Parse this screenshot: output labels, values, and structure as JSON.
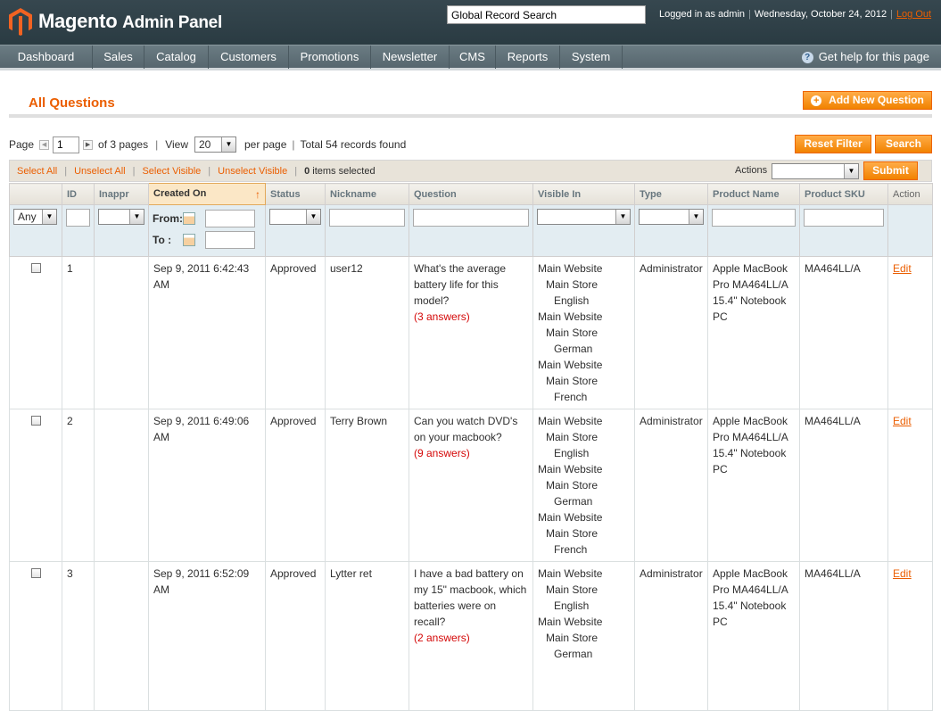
{
  "header": {
    "logo_brand": "Magento",
    "logo_suffix": "Admin Panel",
    "search_placeholder": "Global Record Search",
    "logged_in": "Logged in as admin",
    "date": "Wednesday, October 24, 2012",
    "logout": "Log Out"
  },
  "nav": {
    "items": [
      "Dashboard",
      "Sales",
      "Catalog",
      "Customers",
      "Promotions",
      "Newsletter",
      "CMS",
      "Reports",
      "System"
    ],
    "help": "Get help for this page"
  },
  "page": {
    "title": "All Questions",
    "add_button": "Add New Question"
  },
  "pager": {
    "page_label": "Page",
    "page_value": "1",
    "of_pages": "of 3 pages",
    "view_label": "View",
    "per_page_value": "20",
    "per_page_label": "per page",
    "total": "Total 54 records found",
    "reset_filter": "Reset Filter",
    "search": "Search"
  },
  "massaction": {
    "select_all": "Select All",
    "unselect_all": "Unselect All",
    "select_visible": "Select Visible",
    "unselect_visible": "Unselect Visible",
    "items_selected_count": "0",
    "items_selected_label": "items selected",
    "actions_label": "Actions",
    "submit": "Submit"
  },
  "columns": {
    "id": "ID",
    "inappr": "Inappr",
    "created_on": "Created On",
    "status": "Status",
    "nickname": "Nickname",
    "question": "Question",
    "visible_in": "Visible In",
    "type": "Type",
    "product_name": "Product Name",
    "product_sku": "Product SKU",
    "action": "Action"
  },
  "filters": {
    "any": "Any",
    "from": "From:",
    "to": "To :"
  },
  "rows": [
    {
      "id": "1",
      "created": "Sep 9, 2011 6:42:43 AM",
      "status": "Approved",
      "nickname": "user12",
      "question": "What's the average battery life for this model?",
      "answers": "(3 answers)",
      "type": "Administrator",
      "product_name": "Apple MacBook Pro MA464LL/A 15.4\" Notebook PC",
      "sku": "MA464LL/A",
      "action": "Edit"
    },
    {
      "id": "2",
      "created": "Sep 9, 2011 6:49:06 AM",
      "status": "Approved",
      "nickname": "Terry Brown",
      "question": "Can you watch DVD's on your macbook?",
      "answers": "(9 answers)",
      "type": "Administrator",
      "product_name": "Apple MacBook Pro MA464LL/A 15.4\" Notebook PC",
      "sku": "MA464LL/A",
      "action": "Edit"
    },
    {
      "id": "3",
      "created": "Sep 9, 2011 6:52:09 AM",
      "status": "Approved",
      "nickname": "Lytter ret",
      "question": "I have a bad battery on my 15\" macbook, which batteries were on recall?",
      "answers": "(2 answers)",
      "type": "Administrator",
      "product_name": "Apple MacBook Pro MA464LL/A 15.4\" Notebook PC",
      "sku": "MA464LL/A",
      "action": "Edit"
    }
  ],
  "visible_in": {
    "website": "Main Website",
    "store": "Main Store",
    "views": [
      "English",
      "German",
      "French"
    ]
  },
  "colors": {
    "accent": "#eb5e00",
    "header_bg": "#2f4047",
    "nav_bg": "#5f6f77",
    "answers": "#d40707"
  }
}
